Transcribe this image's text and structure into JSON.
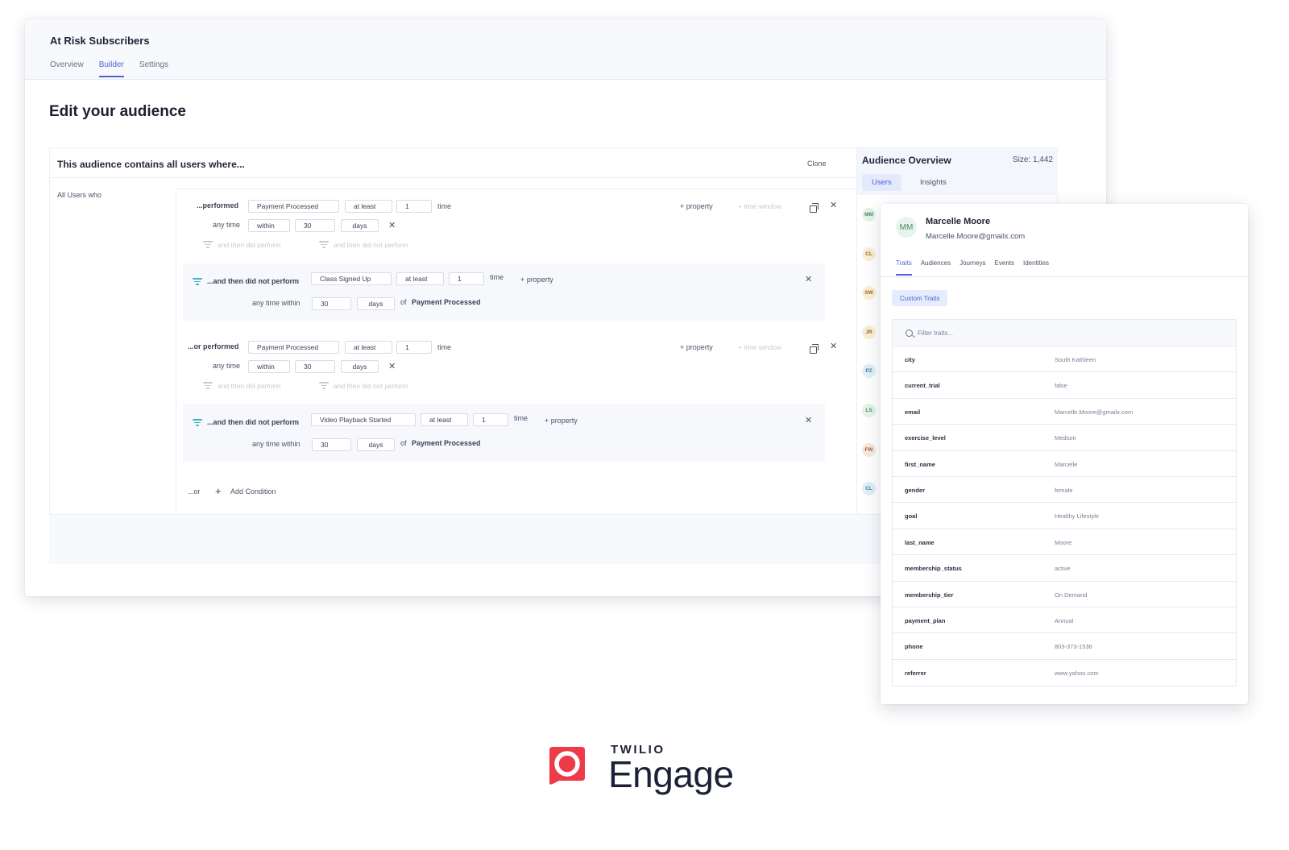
{
  "window": {
    "title": "At Risk Subscribers",
    "tabs": [
      "Overview",
      "Builder",
      "Settings"
    ]
  },
  "page_title": "Edit your audience",
  "builder": {
    "title": "This audience contains all users where...",
    "clone_label": "Clone",
    "all_users_label": "All Users who",
    "group1": {
      "performed_label": "...performed",
      "event": "Payment Processed",
      "operator": "at least",
      "count": "1",
      "time_label": "time",
      "anytime_label": "any time",
      "within": "within",
      "days_value": "30",
      "days_unit": "days",
      "add_property": "+ property",
      "time_window": "+ time window",
      "then_did_perform": "and then did perform",
      "then_did_not_perform": "and then did not perform",
      "sub": {
        "label": "...and then did not perform",
        "event": "Class Signed Up",
        "operator": "at least",
        "count": "1",
        "time_label": "time",
        "add_property": "+ property",
        "anytime_within_label": "any time within",
        "days_value": "30",
        "days_unit": "days",
        "of_label": "of",
        "of_event": "Payment Processed"
      }
    },
    "group2": {
      "performed_label": "...or performed",
      "event": "Payment Processed",
      "operator": "at least",
      "count": "1",
      "time_label": "time",
      "anytime_label": "any time",
      "within": "within",
      "days_value": "30",
      "days_unit": "days",
      "add_property": "+ property",
      "time_window": "+ time window",
      "then_did_perform": "and then did perform",
      "then_did_not_perform": "and then did not perform",
      "sub": {
        "label": "...and then did not perform",
        "event": "Video Playback Started",
        "operator": "at least",
        "count": "1",
        "time_label": "time",
        "add_property": "+ property",
        "anytime_within_label": "any time within",
        "days_value": "30",
        "days_unit": "days",
        "of_label": "of",
        "of_event": "Payment Processed"
      }
    },
    "or_label": "...or",
    "add_condition": "Add Condition"
  },
  "overview": {
    "title": "Audience Overview",
    "size": "Size: 1,442",
    "tabs": [
      "Users",
      "Insights"
    ],
    "avatars": [
      {
        "initials": "MM",
        "bg": "#e3f3e8",
        "fg": "#4e8a64"
      },
      {
        "initials": "CL",
        "bg": "#fbeed6",
        "fg": "#9a6a1c"
      },
      {
        "initials": "SW",
        "bg": "#fbeed6",
        "fg": "#9a6a1c"
      },
      {
        "initials": "JR",
        "bg": "#fbeed6",
        "fg": "#9a6a1c"
      },
      {
        "initials": "PZ",
        "bg": "#dff0f7",
        "fg": "#3f7f96"
      },
      {
        "initials": "LS",
        "bg": "#e3f3e8",
        "fg": "#4e8a64"
      },
      {
        "initials": "FW",
        "bg": "#f8e6dc",
        "fg": "#a0643e"
      },
      {
        "initials": "CL",
        "bg": "#dff0f7",
        "fg": "#3f7f96"
      }
    ]
  },
  "profile": {
    "initials": "MM",
    "name": "Marcelle Moore",
    "email": "Marcelle.Moore@gmailx.com",
    "tabs": [
      "Traits",
      "Audiences",
      "Journeys",
      "Events",
      "Identities"
    ],
    "custom_traits": "Custom Traits",
    "filter_placeholder": "Filter traits...",
    "traits": [
      {
        "key": "city",
        "value": "South Kathleen"
      },
      {
        "key": "current_trial",
        "value": "false"
      },
      {
        "key": "email",
        "value": "Marcelle.Moore@gmailx.com"
      },
      {
        "key": "exercise_level",
        "value": "Medium"
      },
      {
        "key": "first_name",
        "value": "Marcelle"
      },
      {
        "key": "gender",
        "value": "female"
      },
      {
        "key": "goal",
        "value": "Healthy Lifestyle"
      },
      {
        "key": "last_name",
        "value": "Moore"
      },
      {
        "key": "membership_status",
        "value": "active"
      },
      {
        "key": "membership_tier",
        "value": "On Demand"
      },
      {
        "key": "payment_plan",
        "value": "Annual"
      },
      {
        "key": "phone",
        "value": "803-373-1536"
      },
      {
        "key": "referrer",
        "value": "www.yahoo.com"
      }
    ]
  },
  "logo": {
    "brand": "TWILIO",
    "product": "Engage",
    "mark_color": "#ef3a4a"
  }
}
